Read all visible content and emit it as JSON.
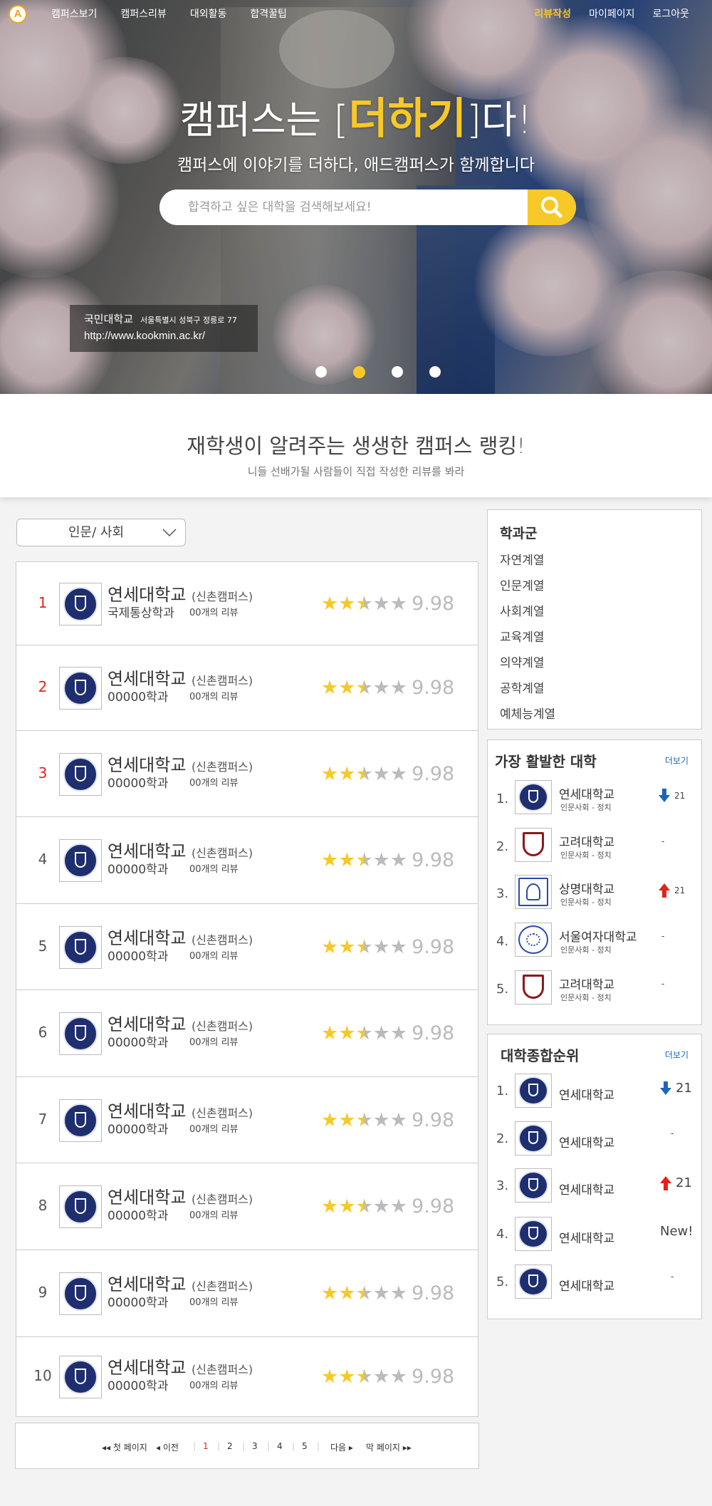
{
  "nav": {
    "logo": "A",
    "left": [
      "캠퍼스보기",
      "캠퍼스리뷰",
      "대외활동",
      "합격꿀팁"
    ],
    "right": [
      "리뷰작성",
      "마이페이지",
      "로그아웃"
    ]
  },
  "hero": {
    "title_pre": "캠퍼스는 [",
    "title_accent": "더하기",
    "title_post": "]다!",
    "subtitle": "캠퍼스에 이야기를 더하다, 애드캠퍼스가 함께합니다",
    "search_placeholder": "합격하고 싶은 대학을 검색해보세요!",
    "caption_name": "국민대학교",
    "caption_address": "서울특별시 성북구 정릉로 77",
    "caption_url": "http://www.kookmin.ac.kr/",
    "slide_count": 4,
    "active_slide": 2
  },
  "banner": {
    "title": "재학생이 알려주는 생생한 캠퍼스 랭킹!",
    "subtitle": "니들 선배가될 사람들이 직접 작성한 리뷰를 봐라"
  },
  "filter": {
    "selected": "인문/ 사회"
  },
  "ranking": [
    {
      "rank": "1",
      "name": "연세대학교",
      "campus": "(신촌캠퍼스)",
      "dept": "국제통상학과",
      "reviews": "00개의 리뷰",
      "rating": 2.5,
      "score": "9.98"
    },
    {
      "rank": "2",
      "name": "연세대학교",
      "campus": "(신촌캠퍼스)",
      "dept": "00000학과",
      "reviews": "00개의 리뷰",
      "rating": 2.5,
      "score": "9.98"
    },
    {
      "rank": "3",
      "name": "연세대학교",
      "campus": "(신촌캠퍼스)",
      "dept": "00000학과",
      "reviews": "00개의 리뷰",
      "rating": 2.5,
      "score": "9.98"
    },
    {
      "rank": "4",
      "name": "연세대학교",
      "campus": "(신촌캠퍼스)",
      "dept": "00000학과",
      "reviews": "00개의 리뷰",
      "rating": 2.5,
      "score": "9.98"
    },
    {
      "rank": "5",
      "name": "연세대학교",
      "campus": "(신촌캠퍼스)",
      "dept": "00000학과",
      "reviews": "00개의 리뷰",
      "rating": 2.5,
      "score": "9.98"
    },
    {
      "rank": "6",
      "name": "연세대학교",
      "campus": "(신촌캠퍼스)",
      "dept": "00000학과",
      "reviews": "00개의 리뷰",
      "rating": 2.5,
      "score": "9.98"
    },
    {
      "rank": "7",
      "name": "연세대학교",
      "campus": "(신촌캠퍼스)",
      "dept": "00000학과",
      "reviews": "00개의 리뷰",
      "rating": 2.5,
      "score": "9.98"
    },
    {
      "rank": "8",
      "name": "연세대학교",
      "campus": "(신촌캠퍼스)",
      "dept": "00000학과",
      "reviews": "00개의 리뷰",
      "rating": 2.5,
      "score": "9.98"
    },
    {
      "rank": "9",
      "name": "연세대학교",
      "campus": "(신촌캠퍼스)",
      "dept": "00000학과",
      "reviews": "00개의 리뷰",
      "rating": 2.5,
      "score": "9.98"
    },
    {
      "rank": "10",
      "name": "연세대학교",
      "campus": "(신촌캠퍼스)",
      "dept": "00000학과",
      "reviews": "00개의 리뷰",
      "rating": 2.5,
      "score": "9.98"
    }
  ],
  "pagination": {
    "first": "◂◂ 첫 페이지",
    "prev": "◂ 이전",
    "pages": [
      "1",
      "2",
      "3",
      "4",
      "5"
    ],
    "current": "1",
    "next": "다음 ▸",
    "last": "막 페이지 ▸▸"
  },
  "categories": {
    "title": "학과군",
    "items": [
      "자연계열",
      "인문계열",
      "사회계열",
      "교육계열",
      "의약계열",
      "공학계열",
      "예체능계열"
    ]
  },
  "active": {
    "title": "가장 활발한 대학",
    "more": "더보기",
    "items": [
      {
        "rank": "1.",
        "name": "연세대학교",
        "dept": "인문사회 - 정치",
        "change": "21",
        "dir": "down",
        "logo": "yonsei"
      },
      {
        "rank": "2.",
        "name": "고려대학교",
        "dept": "인문사회 - 정치",
        "change": "-",
        "dir": "none",
        "logo": "korea"
      },
      {
        "rank": "3.",
        "name": "상명대학교",
        "dept": "인문사회 - 정치",
        "change": "21",
        "dir": "up",
        "logo": "sangmyung"
      },
      {
        "rank": "4.",
        "name": "서울여자대학교",
        "dept": "인문사회 - 정치",
        "change": "-",
        "dir": "none",
        "logo": "swu"
      },
      {
        "rank": "5.",
        "name": "고려대학교",
        "dept": "인문사회 - 정치",
        "change": "-",
        "dir": "none",
        "logo": "korea"
      }
    ]
  },
  "overall": {
    "title": "대학종합순위",
    "more": "더보기",
    "items": [
      {
        "rank": "1.",
        "name": "연세대학교",
        "change": "21",
        "dir": "down"
      },
      {
        "rank": "2.",
        "name": "연세대학교",
        "change": "-",
        "dir": "none"
      },
      {
        "rank": "3.",
        "name": "연세대학교",
        "change": "21",
        "dir": "up"
      },
      {
        "rank": "4.",
        "name": "연세대학교",
        "change": "New!",
        "dir": "none"
      },
      {
        "rank": "5.",
        "name": "연세대학교",
        "change": "-",
        "dir": "none"
      }
    ]
  },
  "colors": {
    "accent": "#f7c928",
    "rank_red": "#e2231a",
    "link_blue": "#1b67b5",
    "star_empty": "#bbbbbb"
  }
}
